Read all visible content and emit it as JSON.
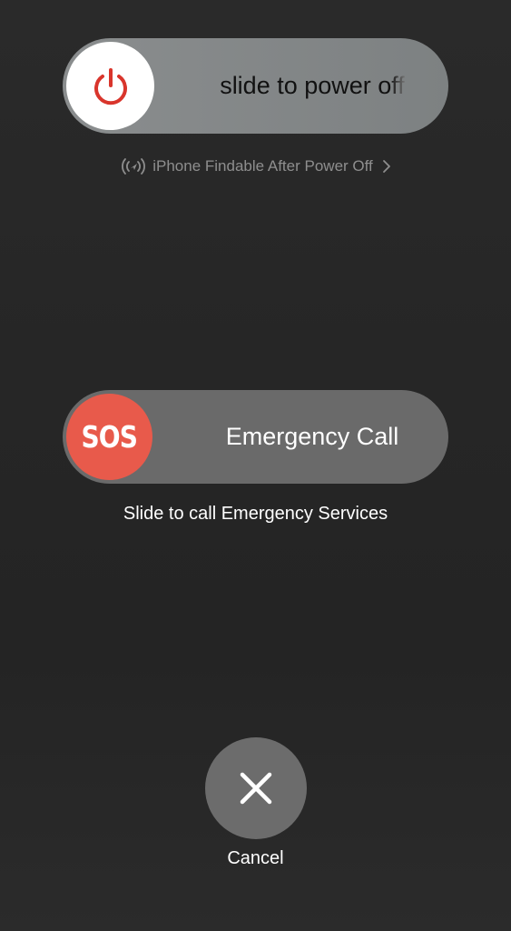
{
  "power_slider": {
    "label": "slide to power off",
    "knob_icon": "power-icon",
    "knob_icon_color": "#d9352c"
  },
  "findable": {
    "icon": "findmy-signal-icon",
    "label": "iPhone Findable After Power Off",
    "chevron": "chevron-right-icon"
  },
  "sos_slider": {
    "knob_label": "SOS",
    "label": "Emergency Call",
    "knob_color": "#e85a4b"
  },
  "sos_caption": "Slide to call Emergency Services",
  "cancel": {
    "icon": "close-icon",
    "label": "Cancel"
  }
}
